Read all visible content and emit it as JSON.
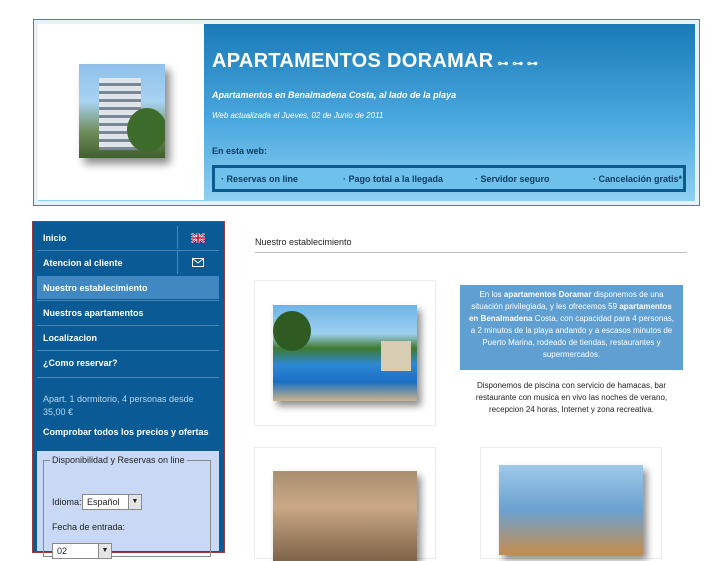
{
  "header": {
    "title": "APARTAMENTOS DORAMAR",
    "subtitle": "Apartamentos en Benalmadena Costa, al lado de la playa",
    "updated": "Web actualizada el Jueves, 02 de Junio de 2011",
    "section_label": "En esta web:",
    "features": [
      "Reservas on line",
      "Pago total a la llegada",
      "Servidor seguro",
      "Cancelación gratis*"
    ]
  },
  "sidebar": {
    "nav": [
      {
        "label": "Inicio",
        "side_icon": "uk-flag-icon"
      },
      {
        "label": "Atencion al cliente",
        "side_icon": "mail-icon"
      },
      {
        "label": "Nuestro establecimiento"
      },
      {
        "label": "Nuestros apartamentos"
      },
      {
        "label": "Localizacion"
      },
      {
        "label": "¿Como reservar?"
      }
    ],
    "apt_text": "Apart. 1 dormitorio, 4 personas desde 35,00 €",
    "check_link": "Comprobar todos los precios y ofertas",
    "booking": {
      "legend": "Disponibilidad y Reservas on line",
      "language_label": "Idioma:",
      "language_value": "Español",
      "date_label": "Fecha de entrada:",
      "day_value": "02"
    }
  },
  "main": {
    "title": "Nuestro establecimiento",
    "info": {
      "p1": "En los",
      "b1": "apartamentos Doramar",
      "p2": "disponemos de una situación privilegiada, y les ofrecemos 59",
      "b2": "apartamentos en Benalmadena",
      "p3": "Costa, con capacidad para 4 personas, a 2 minutos de la playa andando y a escasos minutos de Puerto Marina, rodeado de tiendas, restaurantes y supermercados."
    },
    "pool_text": "Disponemos de piscina con servicio de hamacas, bar restaurante con musica en vivo las noches de verano, recepcion 24 horas, Internet y zona recreativa."
  }
}
